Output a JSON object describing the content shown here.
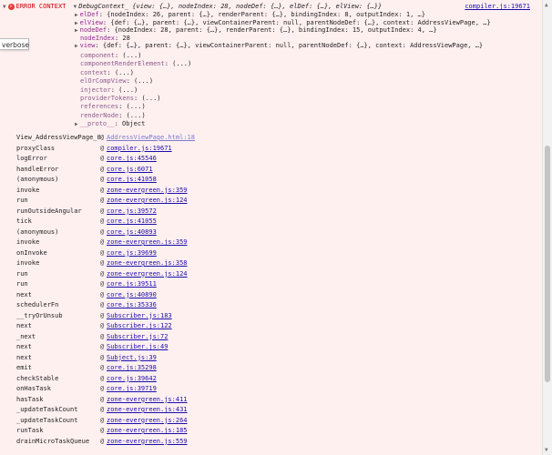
{
  "header": {
    "error_label": "ERROR CONTEXT",
    "context_summary": "DebugContext_ {view: {…}, nodeIndex: 28, nodeDef: {…}, elDef: {…}, elView: {…}}",
    "source_link": "compiler.js:19671",
    "error_icon": "x-circle-icon"
  },
  "verbose_chip": {
    "label": "verbose"
  },
  "context_props": [
    {
      "key": "elDef",
      "value": "{nodeIndex: 26, parent: {…}, renderParent: {…}, bindingIndex: 8, outputIndex: 1, …}",
      "expandable": true
    },
    {
      "key": "elView",
      "value": "{def: {…}, parent: {…}, viewContainerParent: null, parentNodeDef: {…}, context: AddressViewPage, …}",
      "expandable": true
    },
    {
      "key": "nodeDef",
      "value": "{nodeIndex: 28, parent: {…}, renderParent: {…}, bindingIndex: 15, outputIndex: 4, …}",
      "expandable": true
    },
    {
      "key": "nodeIndex",
      "value": "28",
      "expandable": false
    },
    {
      "key": "view",
      "value": "{def: {…}, parent: {…}, viewContainerParent: null, parentNodeDef: {…}, context: AddressViewPage, …}",
      "expandable": true
    }
  ],
  "getters": [
    {
      "key": "component",
      "value": "(...)"
    },
    {
      "key": "componentRenderElement",
      "value": "(...)"
    },
    {
      "key": "context",
      "value": "(...)"
    },
    {
      "key": "elOrCompView",
      "value": "(...)"
    },
    {
      "key": "injector",
      "value": "(...)"
    },
    {
      "key": "providerTokens",
      "value": "(...)"
    },
    {
      "key": "references",
      "value": "(...)"
    },
    {
      "key": "renderNode",
      "value": "(...)"
    }
  ],
  "proto": {
    "key": "__proto__",
    "value": "Object"
  },
  "stack": [
    {
      "fn": "View_AddressViewPage_0",
      "src": "AddressViewPage.html:18"
    },
    {
      "fn": "proxyClass",
      "src": "compiler.js:19671"
    },
    {
      "fn": "logError",
      "src": "core.js:45546"
    },
    {
      "fn": "handleError",
      "src": "core.js:6071"
    },
    {
      "fn": "(anonymous)",
      "src": "core.js:41058"
    },
    {
      "fn": "invoke",
      "src": "zone-evergreen.js:359"
    },
    {
      "fn": "run",
      "src": "zone-evergreen.js:124"
    },
    {
      "fn": "runOutsideAngular",
      "src": "core.js:39572"
    },
    {
      "fn": "tick",
      "src": "core.js:41055"
    },
    {
      "fn": "(anonymous)",
      "src": "core.js:40893"
    },
    {
      "fn": "invoke",
      "src": "zone-evergreen.js:359"
    },
    {
      "fn": "onInvoke",
      "src": "core.js:39699"
    },
    {
      "fn": "invoke",
      "src": "zone-evergreen.js:358"
    },
    {
      "fn": "run",
      "src": "zone-evergreen.js:124"
    },
    {
      "fn": "run",
      "src": "core.js:39511"
    },
    {
      "fn": "next",
      "src": "core.js:40890"
    },
    {
      "fn": "schedulerFn",
      "src": "core.js:35336"
    },
    {
      "fn": "__tryOrUnsub",
      "src": "Subscriber.js:183"
    },
    {
      "fn": "next",
      "src": "Subscriber.js:122"
    },
    {
      "fn": "_next",
      "src": "Subscriber.js:72"
    },
    {
      "fn": "next",
      "src": "Subscriber.js:49"
    },
    {
      "fn": "next",
      "src": "Subject.js:39"
    },
    {
      "fn": "emit",
      "src": "core.js:35298"
    },
    {
      "fn": "checkStable",
      "src": "core.js:39642"
    },
    {
      "fn": "onHasTask",
      "src": "core.js:39719"
    },
    {
      "fn": "hasTask",
      "src": "zone-evergreen.js:411"
    },
    {
      "fn": "_updateTaskCount",
      "src": "zone-evergreen.js:431"
    },
    {
      "fn": "_updateTaskCount",
      "src": "zone-evergreen.js:264"
    },
    {
      "fn": "runTask",
      "src": "zone-evergreen.js:185"
    },
    {
      "fn": "drainMicroTaskQueue",
      "src": "zone-evergreen.js:559"
    }
  ],
  "stack_at": "@"
}
